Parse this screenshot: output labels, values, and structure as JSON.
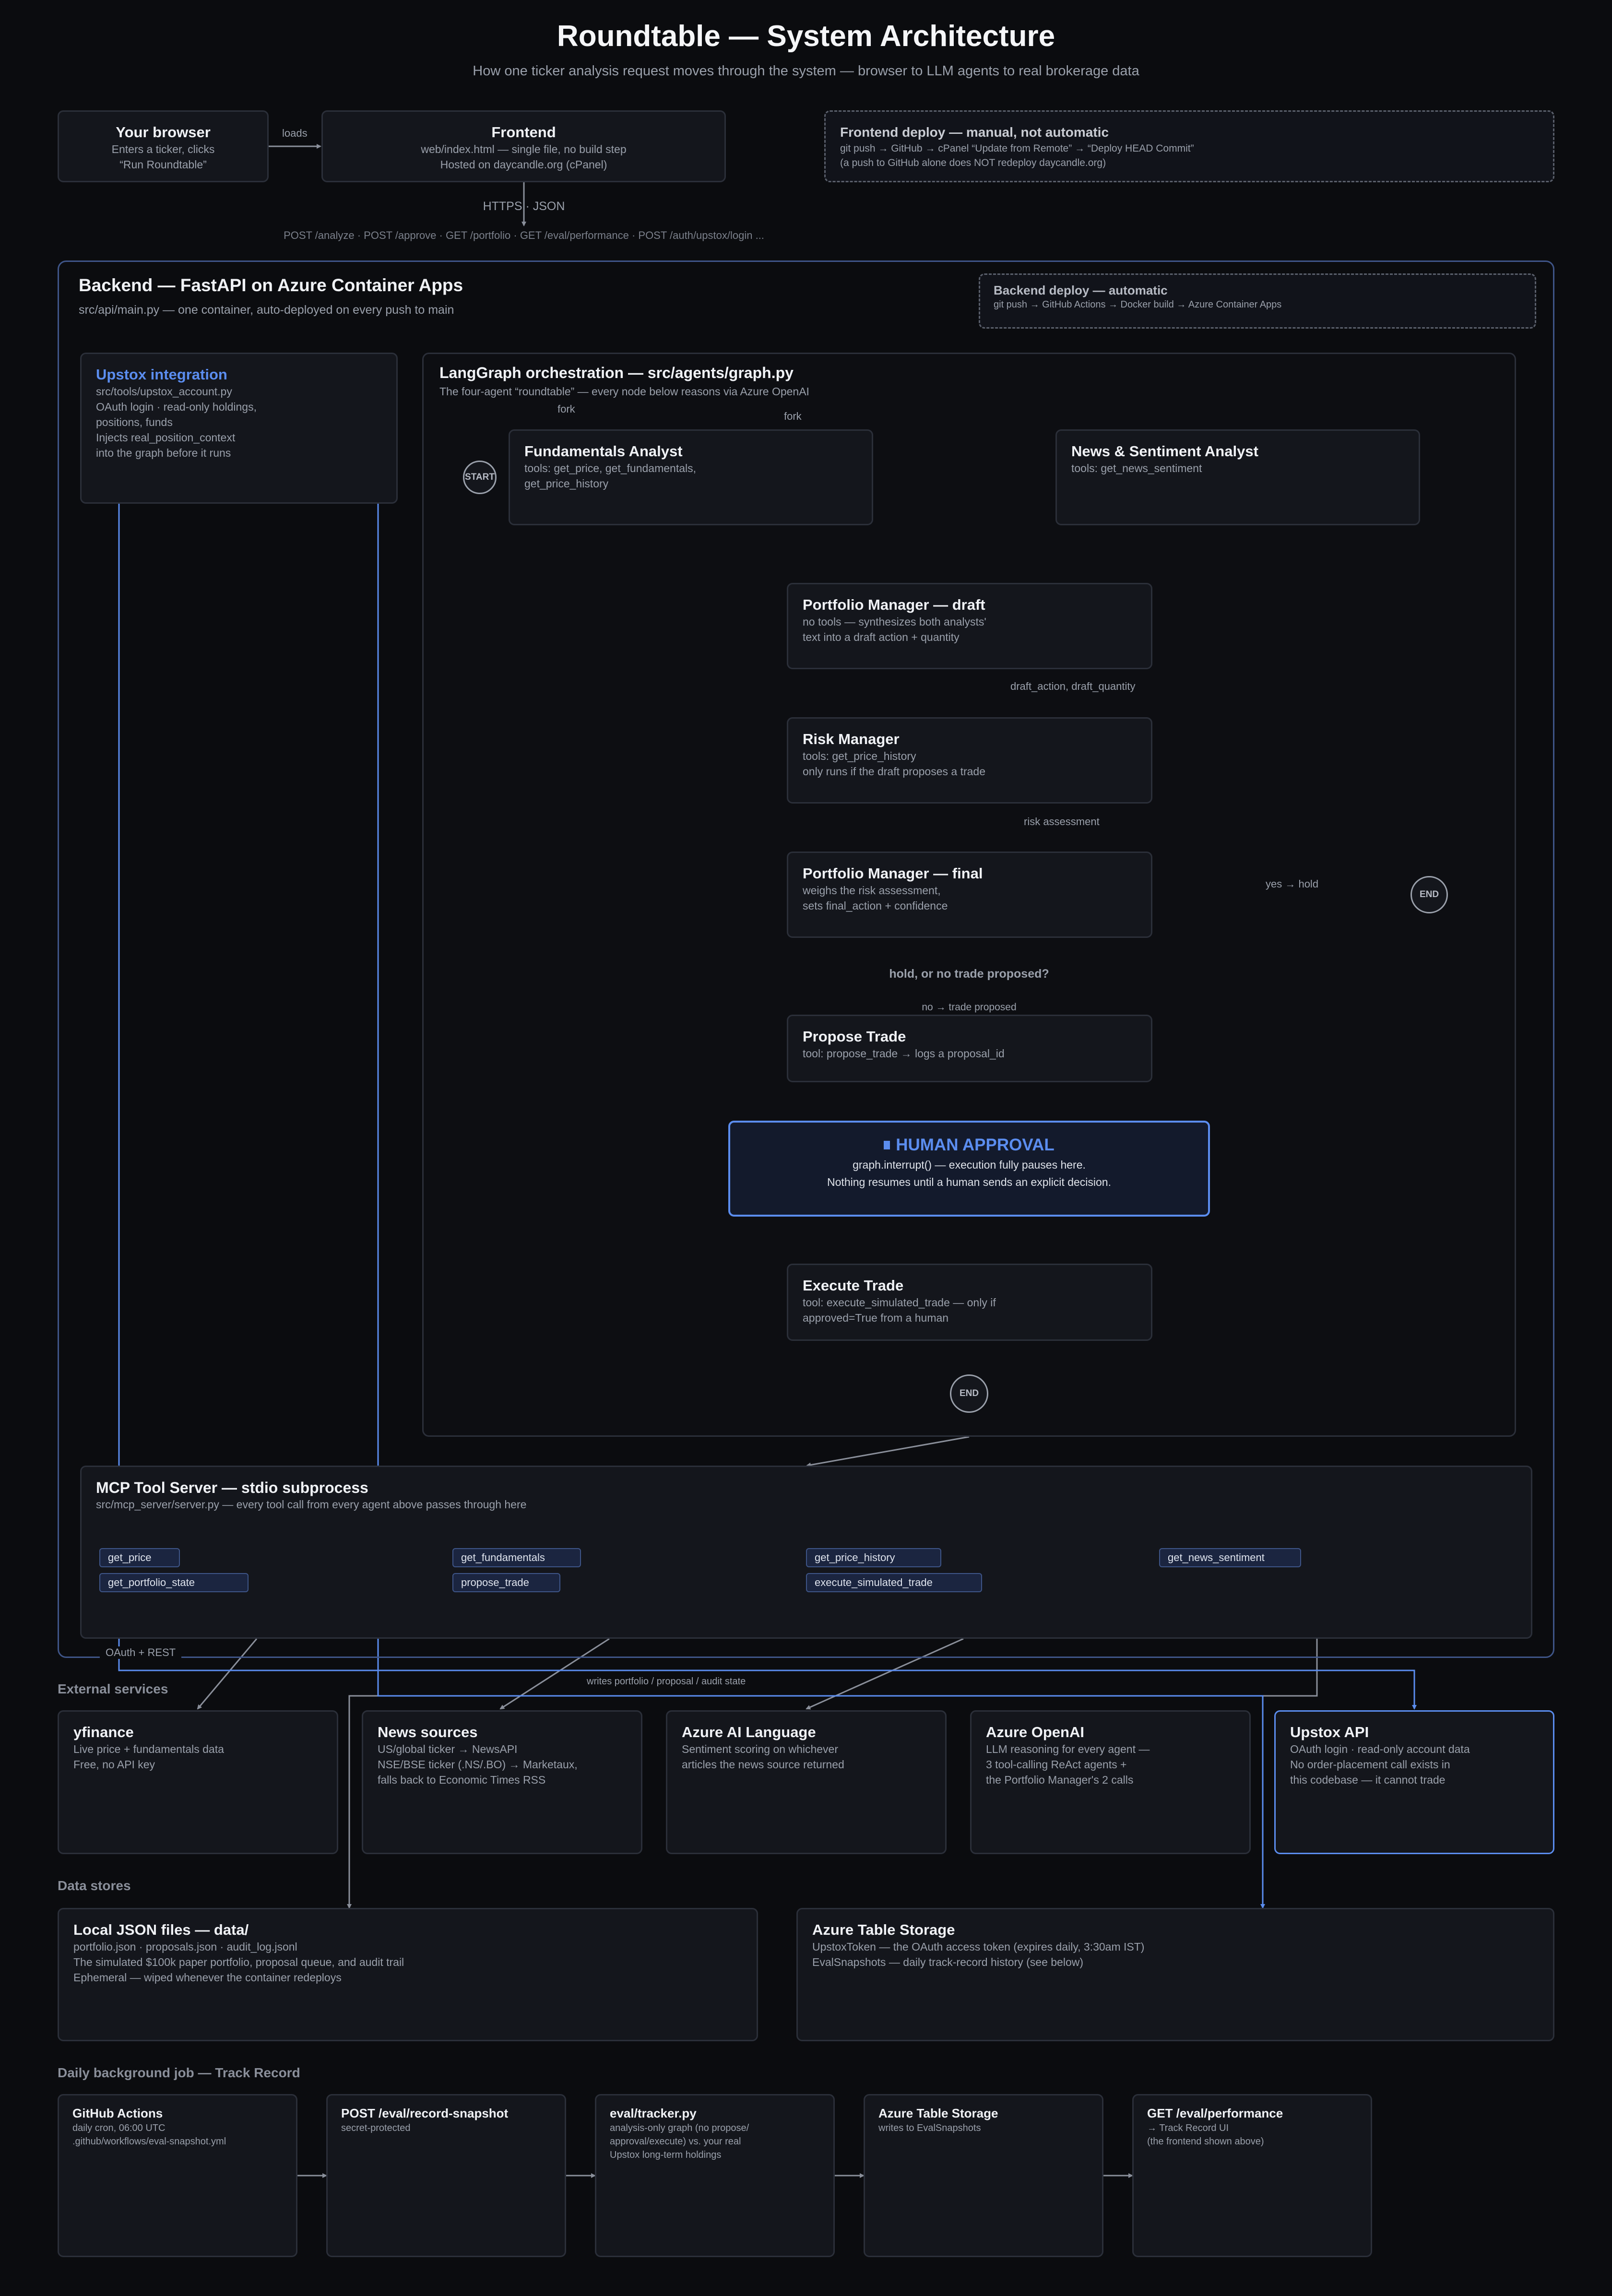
{
  "title": "Roundtable — System Architecture",
  "subtitle": "How one ticker analysis request moves through the system — browser to LLM agents to real brokerage data",
  "browser": {
    "title": "Your browser",
    "line1": "Enters a ticker, clicks",
    "line2": "“Run Roundtable”"
  },
  "frontend": {
    "title": "Frontend",
    "line1": "web/index.html — single file, no build step",
    "line2": "Hosted on daycandle.org (cPanel)"
  },
  "frontend_deploy": {
    "title": "Frontend deploy — manual, not automatic",
    "line1": "git push → GitHub → cPanel “Update from Remote” → “Deploy HEAD Commit”",
    "line2": "(a push to GitHub alone does NOT redeploy daycandle.org)"
  },
  "edges": {
    "loads": "loads",
    "https_json": "HTTPS · JSON",
    "endpoints": "POST /analyze · POST /approve · GET /portfolio · GET /eval/performance · POST /auth/upstox/login ...",
    "fork_left": "fork",
    "fork_right": "fork",
    "draft_out": "draft_action, draft_quantity",
    "risk_out": "risk assessment",
    "yes_hold": "yes → hold",
    "no_trade": "no → trade proposed",
    "oauth_rest": "OAuth + REST",
    "writes": "writes portfolio / proposal / audit state"
  },
  "backend": {
    "title": "Backend — FastAPI on Azure Container Apps",
    "sub": "src/api/main.py — one container, auto-deployed on every push to main"
  },
  "backend_deploy": {
    "title": "Backend deploy — automatic",
    "line1": "git push → GitHub Actions → Docker build → Azure Container Apps"
  },
  "upstox_integration": {
    "title": "Upstox integration",
    "lines": [
      "src/tools/upstox_account.py",
      "OAuth login · read-only holdings,",
      "positions, funds",
      "Injects real_position_context",
      "into the graph before it runs"
    ]
  },
  "langgraph": {
    "title": "LangGraph orchestration — src/agents/graph.py",
    "sub": "The four-agent “roundtable” — every node below reasons via Azure OpenAI"
  },
  "nodes": {
    "start": "START",
    "end1": "END",
    "end2": "END",
    "fundamentals": {
      "title": "Fundamentals Analyst",
      "line1": "tools: get_price, get_fundamentals,",
      "line2": "get_price_history"
    },
    "news": {
      "title": "News & Sentiment Analyst",
      "line1": "tools: get_news_sentiment"
    },
    "pm_draft": {
      "title": "Portfolio Manager — draft",
      "line1": "no tools — synthesizes both analysts'",
      "line2": "text into a draft action + quantity"
    },
    "risk": {
      "title": "Risk Manager",
      "line1": "tools: get_price_history",
      "line2": "only runs if the draft proposes a trade"
    },
    "pm_final": {
      "title": "Portfolio Manager — final",
      "line1": "weighs the risk assessment,",
      "line2": "sets final_action + confidence"
    },
    "decision": "hold, or no trade proposed?",
    "propose": {
      "title": "Propose Trade",
      "line1": "tool: propose_trade → logs a proposal_id"
    },
    "human": {
      "title": "HUMAN APPROVAL",
      "line1": "graph.interrupt() — execution fully pauses here.",
      "line2": "Nothing resumes until a human sends an explicit decision."
    },
    "execute": {
      "title": "Execute Trade",
      "line1": "tool: execute_simulated_trade — only if",
      "line2": "approved=True from a human"
    }
  },
  "mcp": {
    "title": "MCP Tool Server — stdio subprocess",
    "sub": "src/mcp_server/server.py — every tool call from every agent above passes through here",
    "tools": [
      "get_price",
      "get_portfolio_state",
      "get_fundamentals",
      "propose_trade",
      "get_price_history",
      "execute_simulated_trade",
      "get_news_sentiment"
    ]
  },
  "external": {
    "label": "External services",
    "yfinance": {
      "title": "yfinance",
      "line1": "Live price + fundamentals data",
      "line2": "Free, no API key"
    },
    "news": {
      "title": "News sources",
      "line1": "US/global ticker → NewsAPI",
      "line2": "NSE/BSE ticker (.NS/.BO) → Marketaux,",
      "line3": "falls back to Economic Times RSS"
    },
    "language": {
      "title": "Azure AI Language",
      "line1": "Sentiment scoring on whichever",
      "line2": "articles the news source returned"
    },
    "openai": {
      "title": "Azure OpenAI",
      "line1": "LLM reasoning for every agent —",
      "line2": "3 tool-calling ReAct agents +",
      "line3": "the Portfolio Manager's 2 calls"
    },
    "upstox_api": {
      "title": "Upstox API",
      "line1": "OAuth login · read-only account data",
      "line2": "No order-placement call exists in",
      "line3": "this codebase — it cannot trade"
    }
  },
  "stores": {
    "label": "Data stores",
    "json": {
      "title": "Local JSON files — data/",
      "line1": "portfolio.json · proposals.json · audit_log.jsonl",
      "line2": "The simulated $100k paper portfolio, proposal queue, and audit trail",
      "line3": "Ephemeral — wiped whenever the container redeploys"
    },
    "table": {
      "title": "Azure Table Storage",
      "line1": "UpstoxToken — the OAuth access token (expires daily, 3:30am IST)",
      "line2": "EvalSnapshots — daily track-record history (see below)"
    }
  },
  "job": {
    "label": "Daily background job — Track Record",
    "gha": {
      "title": "GitHub Actions",
      "line1": "daily cron, 06:00 UTC",
      "line2": ".github/workflows/eval-snapshot.yml"
    },
    "snapshot": {
      "title": "POST /eval/record-snapshot",
      "line1": "secret-protected"
    },
    "tracker": {
      "title": "eval/tracker.py",
      "line1": "analysis-only graph (no propose/",
      "line2": "approval/execute) vs. your real",
      "line3": "Upstox long-term holdings"
    },
    "table": {
      "title": "Azure Table Storage",
      "line1": "writes to EvalSnapshots"
    },
    "perf": {
      "title": "GET /eval/performance",
      "line1": "→ Track Record UI",
      "line2": "(the frontend shown above)"
    }
  },
  "colors": {
    "background": "#0b0c0f",
    "panel": "#14161c",
    "border": "#2b2f39",
    "accent": "#5b8def",
    "line": "#8a8f9a"
  }
}
